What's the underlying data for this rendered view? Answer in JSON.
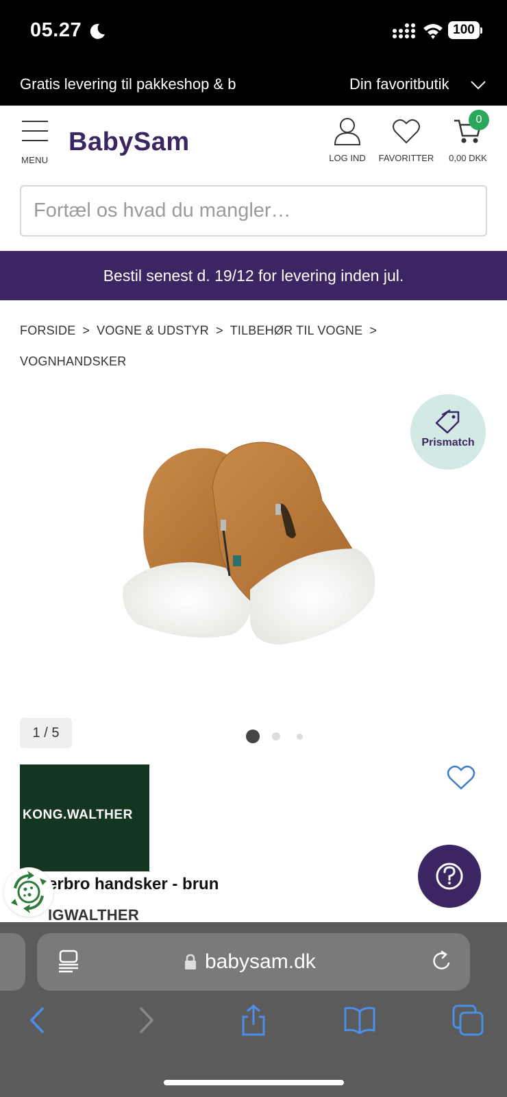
{
  "status_bar": {
    "time": "05.27",
    "battery": "100"
  },
  "promo": {
    "text": "Gratis levering til pakkeshop & b",
    "favorite_store": "Din favoritbutik"
  },
  "header": {
    "logo": "BabySam",
    "menu_label": "MENU",
    "login_label": "LOG IND",
    "favorites_label": "FAVORITTER",
    "cart_total": "0,00 DKK",
    "cart_count": "0"
  },
  "search": {
    "placeholder": "Fortæl os hvad du mangler…"
  },
  "delivery_banner": "Bestil senest d. 19/12 for levering inden jul.",
  "breadcrumb": [
    "FORSIDE",
    "VOGNE & UDSTYR",
    "TILBEHØR TIL VOGNE",
    "VOGNHANDSKER"
  ],
  "product": {
    "prismatch_label": "Prismatch",
    "image_counter": "1 / 5",
    "carousel_dots": 3,
    "active_dot": 0,
    "brand_logo_text": "KONG.WALTHER",
    "title": "erbro handsker - brun",
    "brand": "IGWALTHER"
  },
  "browser": {
    "url": "babysam.dk"
  },
  "colors": {
    "brand_purple": "#3b2562",
    "cart_badge": "#2aa85a",
    "prismatch_bg": "#d3e9e6",
    "brand_logo_bg": "#143620",
    "ios_blue": "#4a8fe8"
  }
}
